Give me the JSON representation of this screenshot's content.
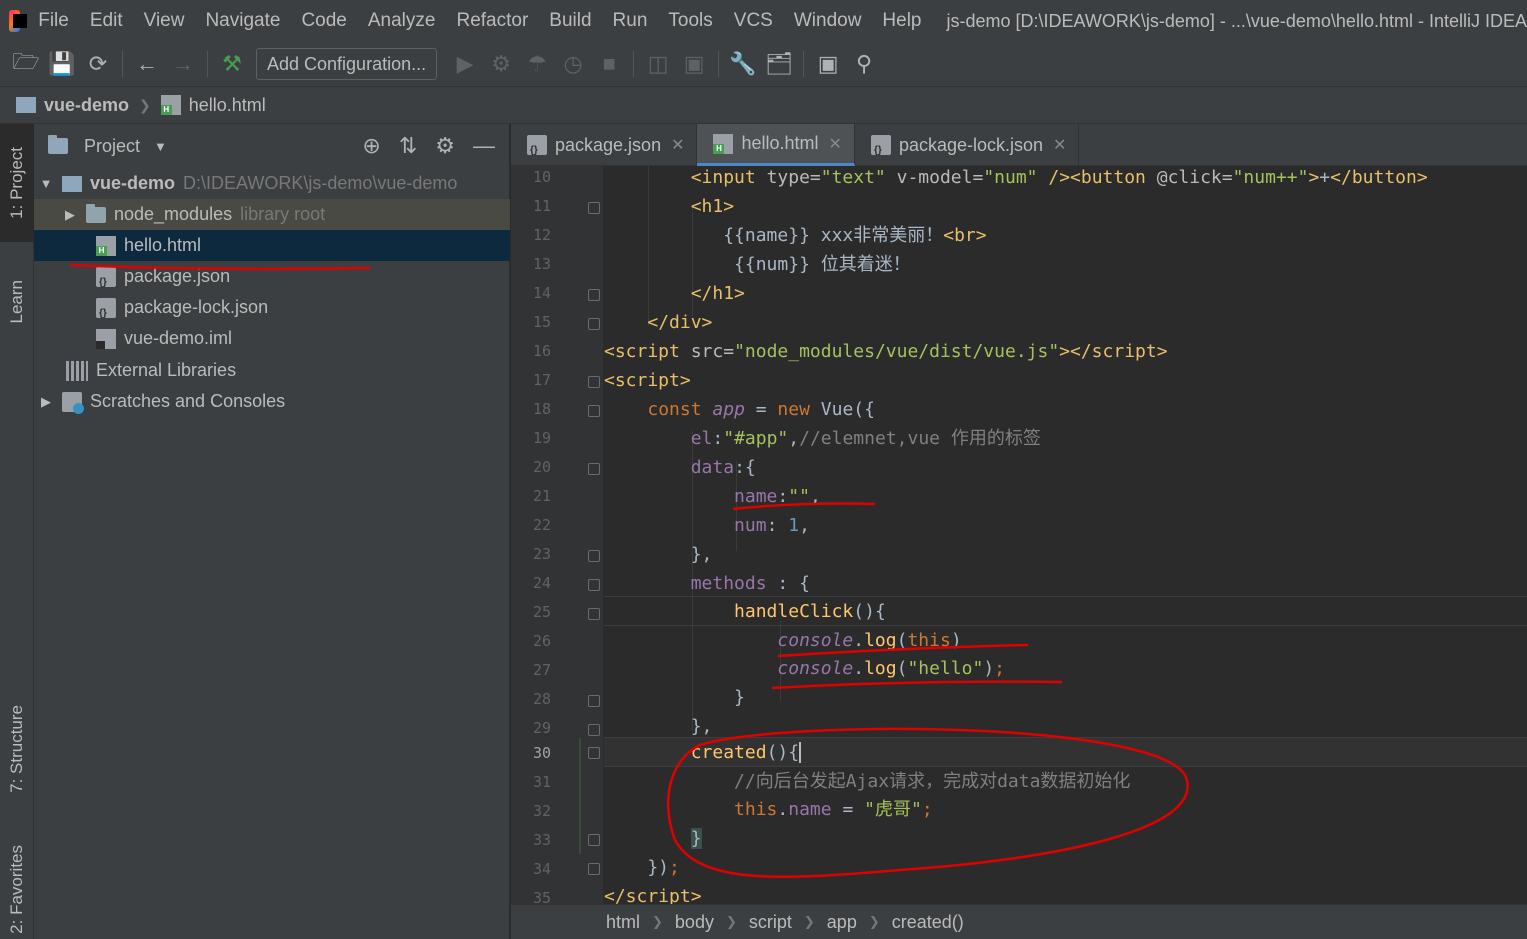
{
  "menubar": {
    "items": [
      "File",
      "Edit",
      "View",
      "Navigate",
      "Code",
      "Analyze",
      "Refactor",
      "Build",
      "Run",
      "Tools",
      "VCS",
      "Window",
      "Help"
    ],
    "window_title": "js-demo [D:\\IDEAWORK\\js-demo] - ...\\vue-demo\\hello.html - IntelliJ IDEA"
  },
  "toolbar": {
    "config_label": "Add Configuration..."
  },
  "navbar": {
    "project": "vue-demo",
    "file": "hello.html"
  },
  "leftstrip": {
    "project_tab": "1: Project",
    "learn_tab": "Learn",
    "structure_tab": "7: Structure",
    "favorites_tab": "2: Favorites"
  },
  "project_panel": {
    "title": "Project",
    "root_name": "vue-demo",
    "root_path": "D:\\IDEAWORK\\js-demo\\vue-demo",
    "node_modules": "node_modules",
    "node_modules_hint": "library root",
    "files": [
      "hello.html",
      "package.json",
      "package-lock.json",
      "vue-demo.iml"
    ],
    "external_libraries": "External Libraries",
    "scratches": "Scratches and Consoles"
  },
  "tabs": [
    {
      "label": "package.json",
      "active": false
    },
    {
      "label": "hello.html",
      "active": true
    },
    {
      "label": "package-lock.json",
      "active": false
    }
  ],
  "editor": {
    "line_numbers": [
      "10",
      "11",
      "12",
      "13",
      "14",
      "15",
      "16",
      "17",
      "18",
      "19",
      "20",
      "21",
      "22",
      "23",
      "24",
      "25",
      "26",
      "27",
      "28",
      "29",
      "30",
      "31",
      "32",
      "33",
      "34",
      "35"
    ],
    "current_line": "30"
  },
  "status_breadcrumb": [
    "html",
    "body",
    "script",
    "app",
    "created()"
  ],
  "colors": {
    "background": "#2b2b2b",
    "panel": "#3c3f41",
    "selection": "#0d293e",
    "annotation": "#e00000"
  }
}
